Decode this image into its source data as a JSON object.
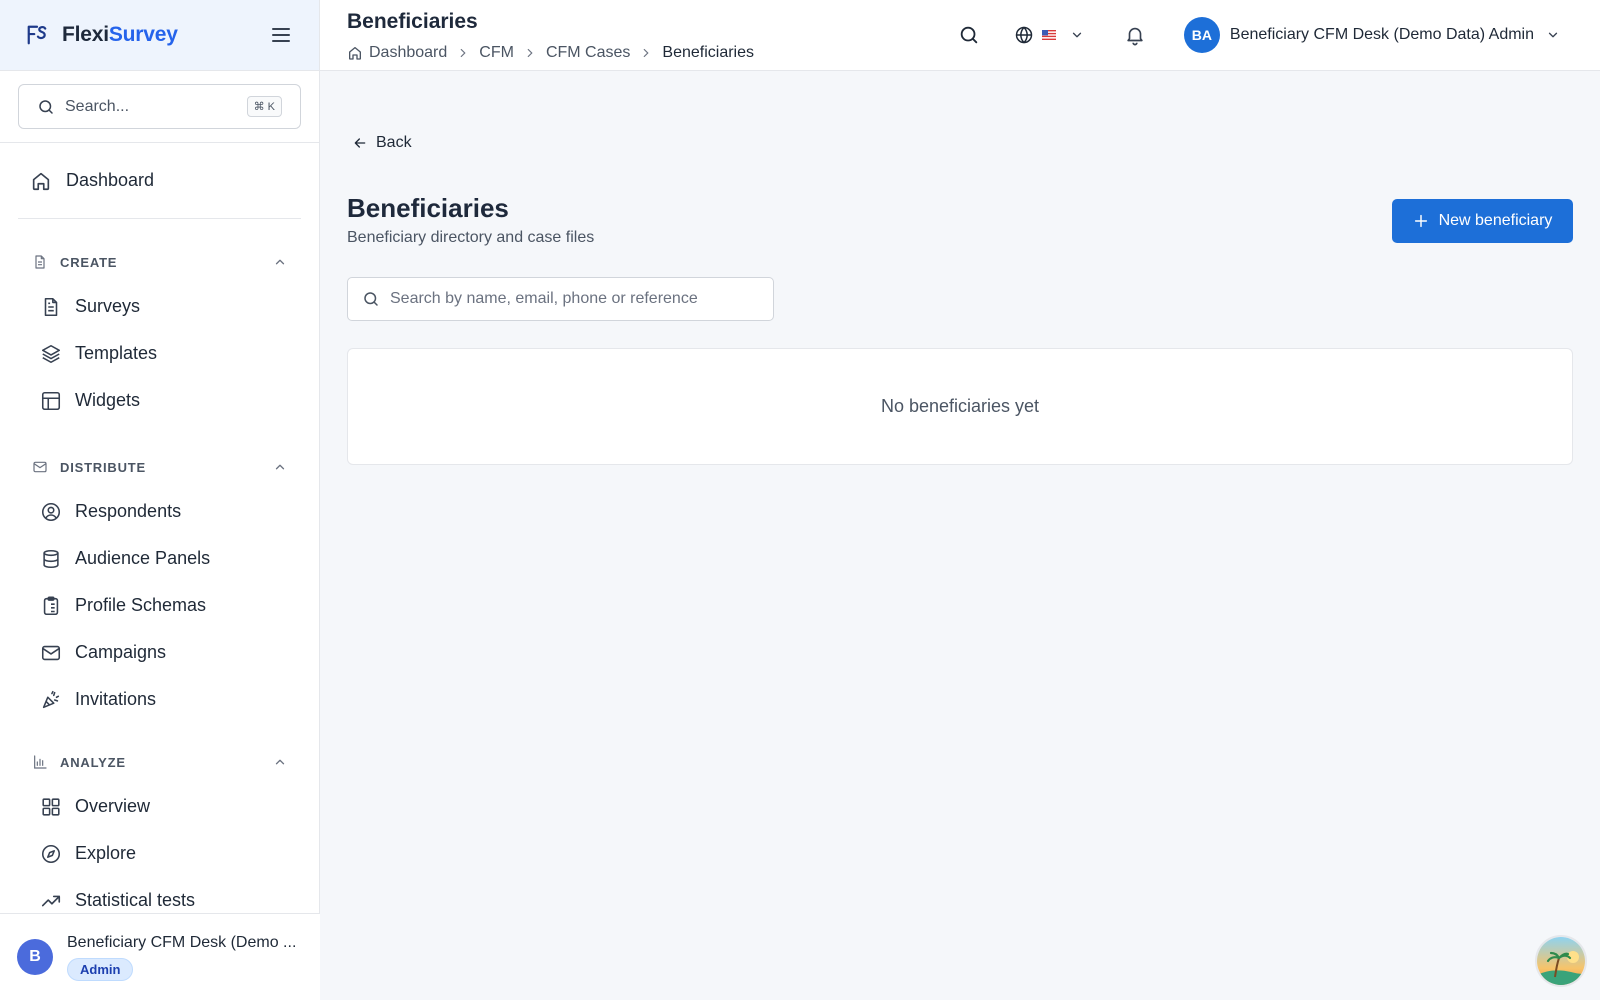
{
  "brand": {
    "name_part1": "Flexi",
    "name_part2": "Survey"
  },
  "sidebar": {
    "search_placeholder": "Search...",
    "search_shortcut": "⌘ K",
    "dashboard_label": "Dashboard",
    "sections": {
      "create": {
        "label": "CREATE",
        "items": [
          "Surveys",
          "Templates",
          "Widgets"
        ]
      },
      "distribute": {
        "label": "DISTRIBUTE",
        "items": [
          "Respondents",
          "Audience Panels",
          "Profile Schemas",
          "Campaigns",
          "Invitations"
        ]
      },
      "analyze": {
        "label": "ANALYZE",
        "items": [
          "Overview",
          "Explore",
          "Statistical tests"
        ]
      }
    },
    "footer": {
      "avatar_initial": "B",
      "name": "Beneficiary CFM Desk (Demo ...",
      "role": "Admin"
    }
  },
  "topbar": {
    "title": "Beneficiaries",
    "breadcrumbs": [
      "Dashboard",
      "CFM",
      "CFM Cases",
      "Beneficiaries"
    ],
    "user": {
      "initials": "BA",
      "name": "Beneficiary CFM Desk (Demo Data) Admin"
    }
  },
  "main": {
    "back_label": "Back",
    "title": "Beneficiaries",
    "subtitle": "Beneficiary directory and case files",
    "new_button_label": "New beneficiary",
    "search_placeholder": "Search by name, email, phone or reference",
    "empty_message": "No beneficiaries yet"
  },
  "colors": {
    "primary": "#1d6fd8",
    "brand_accent": "#2563eb",
    "background": "#f5f7fa"
  }
}
